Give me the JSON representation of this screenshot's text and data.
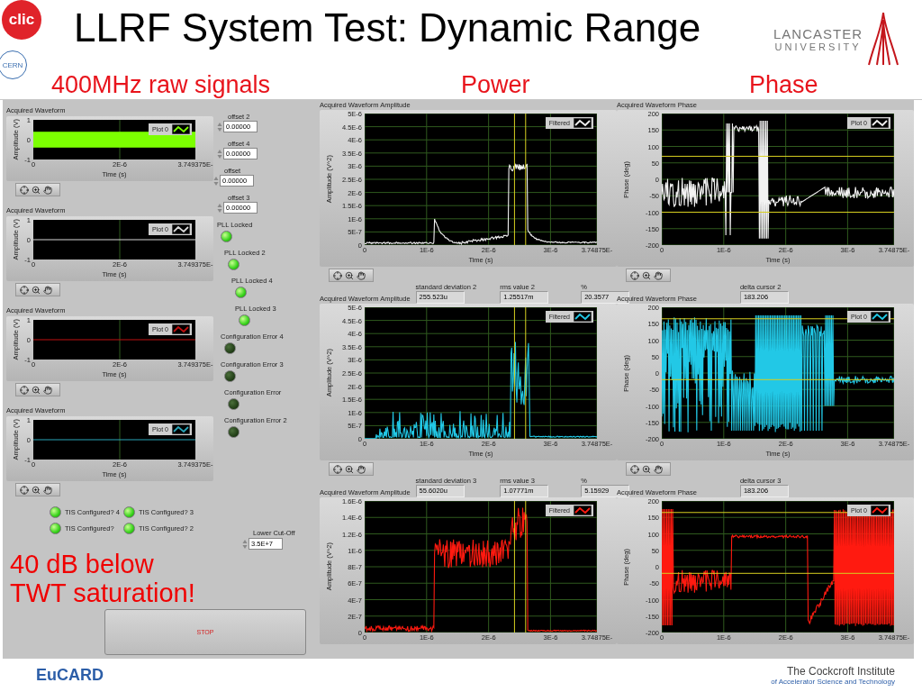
{
  "header": {
    "title": "LLRF System Test: Dynamic Range",
    "clic_logo": "clic",
    "cern_logo": "CERN",
    "university_logo": {
      "line_1": "LANCASTER",
      "line_2": "UNIVERSITY"
    }
  },
  "section_labels": [
    "400MHz raw signals",
    "Power",
    "Phase"
  ],
  "panel": {
    "raw_graphs": [
      {
        "title": "Acquired Waveform",
        "ylabel": "Amplitude (V)",
        "yticks": [
          "1",
          "0",
          "-1"
        ],
        "xticks": [
          "0",
          "2E-6",
          "3.749375E-"
        ],
        "xlabel": "Time (s)",
        "legend": "Plot 0",
        "kind": "band",
        "color": "#7cff00"
      },
      {
        "title": "Acquired Waveform",
        "ylabel": "Amplitude (V)",
        "yticks": [
          "1",
          "0",
          "-1"
        ],
        "xticks": [
          "0",
          "2E-6",
          "3.749375E-"
        ],
        "xlabel": "Time (s)",
        "legend": "Plot 0",
        "kind": "flat",
        "color": "#d8d8d8"
      },
      {
        "title": "Acquired Waveform",
        "ylabel": "Amplitude (V)",
        "yticks": [
          "1",
          "0",
          "-1"
        ],
        "xticks": [
          "0",
          "2E-6",
          "3.749375E-"
        ],
        "xlabel": "Time (s)",
        "legend": "Plot 0",
        "kind": "flat",
        "color": "#c01010"
      },
      {
        "title": "Acquired Waveform",
        "ylabel": "Amplitude (V)",
        "yticks": [
          "1",
          "0",
          "-1"
        ],
        "xticks": [
          "0",
          "2E-6",
          "3.749375E-"
        ],
        "xlabel": "Time (s)",
        "legend": "Plot 0",
        "kind": "flat",
        "color": "#2aa6b8"
      }
    ],
    "offsets": [
      {
        "label": "offset 2",
        "value": "0.00000"
      },
      {
        "label": "offset 4",
        "value": "0.00000"
      },
      {
        "label": "offset",
        "value": "0.00000"
      },
      {
        "label": "offset 3",
        "value": "0.00000"
      }
    ],
    "indicators": [
      {
        "label": "PLL Locked",
        "on": true
      },
      {
        "label": "PLL Locked 2",
        "on": true
      },
      {
        "label": "PLL Locked 4",
        "on": true
      },
      {
        "label": "PLL Locked 3",
        "on": true
      },
      {
        "label": "Configuration Error 4",
        "on": false
      },
      {
        "label": "Configuration Error 3",
        "on": false
      },
      {
        "label": "Configuration Error",
        "on": false
      },
      {
        "label": "Configuration Error 2",
        "on": false
      }
    ],
    "tis_indicators": [
      {
        "label": "TIS Configured? 4",
        "on": true
      },
      {
        "label": "TIS Configured? 3",
        "on": true
      },
      {
        "label": "TIS Configured?",
        "on": true
      },
      {
        "label": "TIS Configured? 2",
        "on": true
      }
    ],
    "lower_cutoff": {
      "label": "Lower Cut-Off",
      "value": "3.5E+7"
    },
    "stop_button": {
      "label": "STOP"
    },
    "power_graphs": [
      {
        "title": "Acquired Waveform Amplitude",
        "ylabel": "Amplitude (V^2)",
        "yticks": [
          "5E-6",
          "4.5E-6",
          "4E-6",
          "3.5E-6",
          "3E-6",
          "2.5E-6",
          "2E-6",
          "1.5E-6",
          "1E-6",
          "5E-7",
          "0"
        ],
        "xticks": [
          "0",
          "1E-6",
          "2E-6",
          "3E-6",
          "3.74875E-"
        ],
        "xlabel": "Time (s)",
        "legend": "Filtered",
        "kind": "pulse",
        "color": "#f2f2f2"
      },
      {
        "title": "Acquired Waveform Amplitude",
        "stats": [
          {
            "label": "standard deviation 2",
            "value": "255.523u"
          },
          {
            "label": "rms value 2",
            "value": "1.25517m"
          },
          {
            "label": "%",
            "value": "20.3577"
          }
        ],
        "ylabel": "Amplitude (V^2)",
        "yticks": [
          "5E-6",
          "4.5E-6",
          "4E-6",
          "3.5E-6",
          "3E-6",
          "2.5E-6",
          "2E-6",
          "1.5E-6",
          "1E-6",
          "5E-7",
          "0"
        ],
        "xticks": [
          "0",
          "1E-6",
          "2E-6",
          "3E-6",
          "3.74875E-"
        ],
        "xlabel": "Time (s)",
        "legend": "Filtered",
        "kind": "spikes",
        "color": "#22c8e6"
      },
      {
        "title": "Acquired Waveform Amplitude",
        "stats": [
          {
            "label": "standard deviation 3",
            "value": "55.6020u"
          },
          {
            "label": "rms value 3",
            "value": "1.07771m"
          },
          {
            "label": "%",
            "value": "5.15929"
          }
        ],
        "ylabel": "Amplitude (V^2)",
        "yticks": [
          "1.6E-6",
          "1.4E-6",
          "1.2E-6",
          "1E-6",
          "8E-7",
          "6E-7",
          "4E-7",
          "2E-7",
          "0"
        ],
        "xticks": [
          "0",
          "1E-6",
          "2E-6",
          "3E-6",
          "3.74875E-"
        ],
        "legend": "Filtered",
        "kind": "step",
        "color": "#ff1a10"
      }
    ],
    "phase_graphs": [
      {
        "title": "Acquired Waveform Phase",
        "ylabel": "Phase (deg)",
        "yticks": [
          "200",
          "150",
          "100",
          "50",
          "0",
          "-50",
          "-100",
          "-150",
          "-200"
        ],
        "xticks": [
          "0",
          "1E-6",
          "2E-6",
          "3E-6",
          "3.74875E-"
        ],
        "xlabel": "Time (s)",
        "legend": "Plot 0",
        "kind": "phase-a",
        "color": "#f2f2f2"
      },
      {
        "title": "Acquired Waveform Phase",
        "stats": [
          {
            "label": "delta cursor 2",
            "value": "183.206"
          }
        ],
        "ylabel": "Phase (deg)",
        "yticks": [
          "200",
          "150",
          "100",
          "50",
          "0",
          "-50",
          "-100",
          "-150",
          "-200"
        ],
        "xticks": [
          "0",
          "1E-6",
          "2E-6",
          "3E-6",
          "3.74875E-"
        ],
        "xlabel": "Time (s)",
        "legend": "Plot 0",
        "kind": "phase-b",
        "color": "#22c8e6"
      },
      {
        "title": "Acquired Waveform Phase",
        "stats": [
          {
            "label": "delta cursor 3",
            "value": "183.206"
          }
        ],
        "ylabel": "Phase (deg)",
        "yticks": [
          "200",
          "150",
          "100",
          "50",
          "0",
          "-50",
          "-100",
          "-150",
          "-200"
        ],
        "xticks": [
          "0",
          "1E-6",
          "2E-6",
          "3E-6",
          "3.74875E-"
        ],
        "legend": "Plot 0",
        "kind": "phase-c",
        "color": "#ff1a10"
      }
    ]
  },
  "annotation": [
    "40 dB below",
    "TWT saturation!"
  ],
  "footer": {
    "eucard_logo": "EuCARD",
    "institute_name": "The Cockcroft Institute",
    "institute_subtitle": "of Accelerator Science and Technology"
  }
}
